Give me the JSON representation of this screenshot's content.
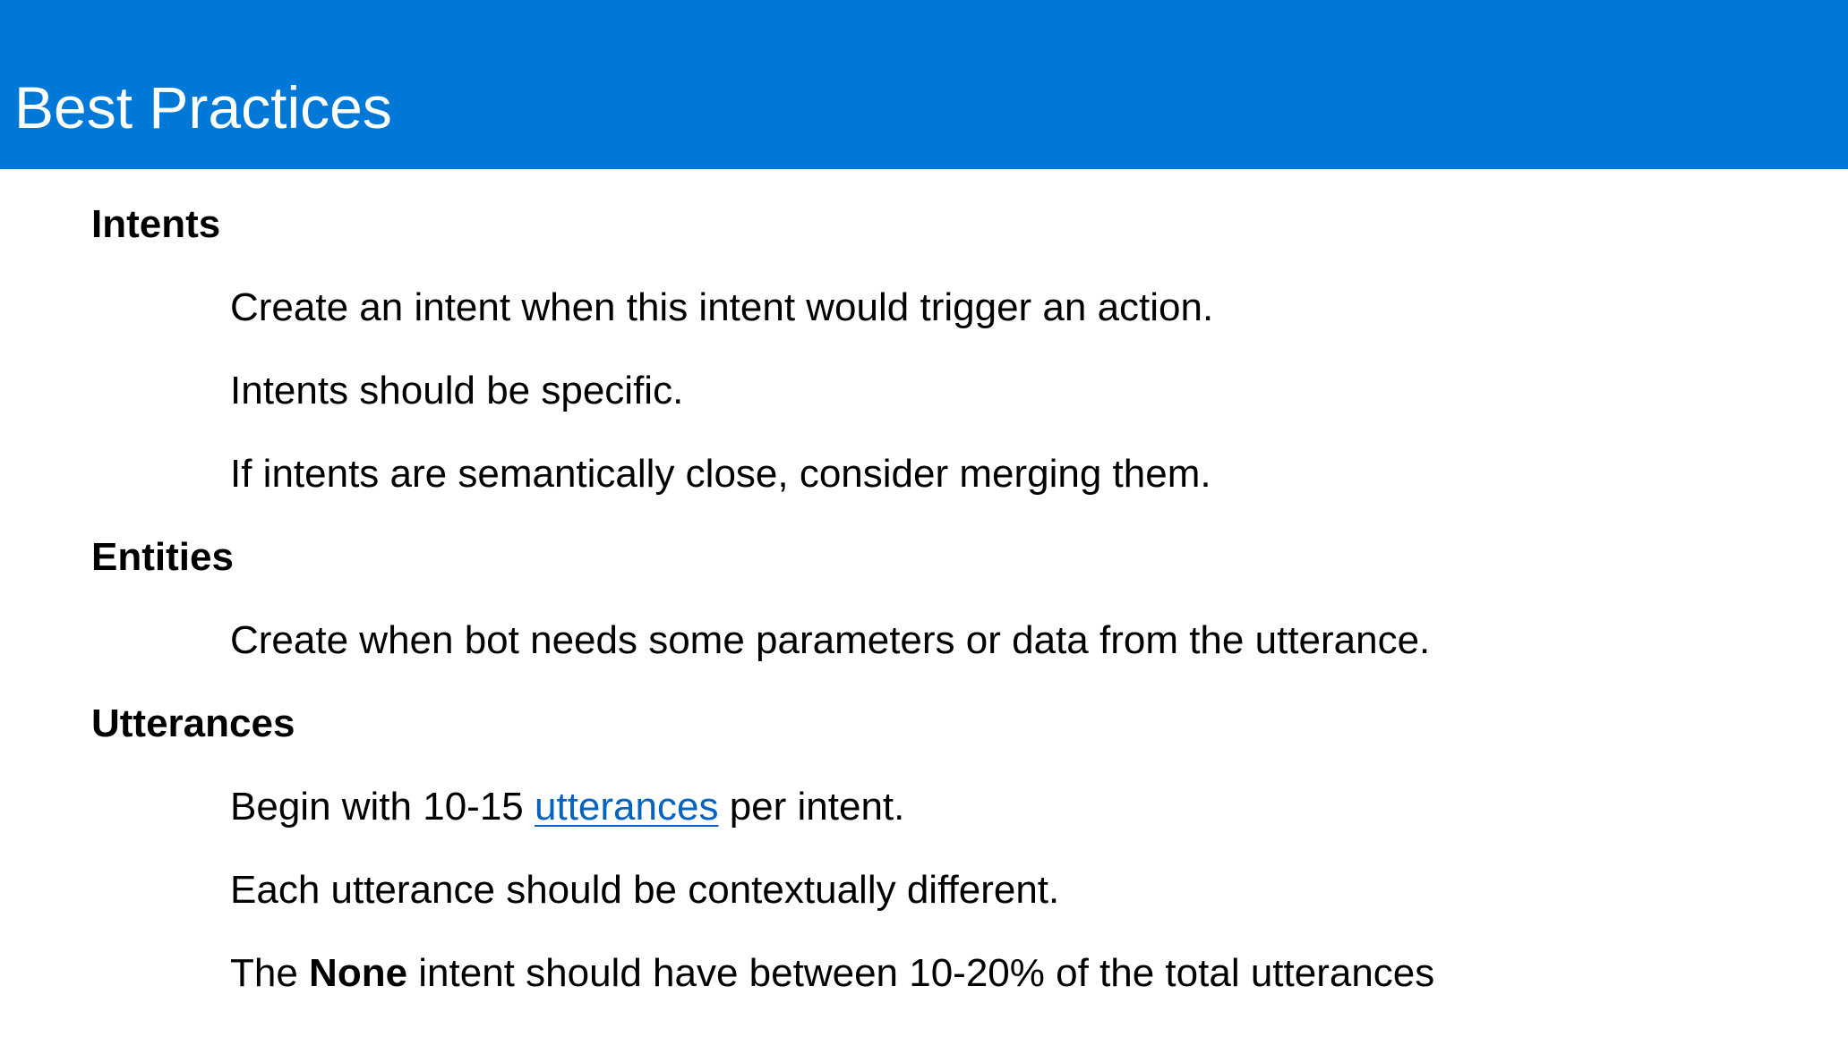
{
  "header": {
    "title": "Best Practices",
    "background_color": "#0078d7"
  },
  "sections": [
    {
      "heading": "Intents",
      "items": [
        "Create an intent when this intent would trigger an action.",
        "Intents should be specific.",
        "If intents are semantically close, consider merging them."
      ]
    },
    {
      "heading": "Entities",
      "items": [
        "Create when bot needs some parameters or data from the utterance."
      ]
    },
    {
      "heading": "Utterances",
      "items": [
        {
          "before": "Begin with 10-15 ",
          "link": "utterances",
          "after": " per intent."
        },
        "Each utterance should be contextually different.",
        {
          "before": "The ",
          "bold": "None",
          "after": " intent should have between 10-20% of the total utterances"
        }
      ]
    }
  ],
  "link_color": "#0563c1"
}
